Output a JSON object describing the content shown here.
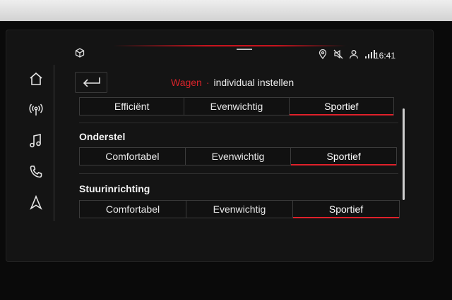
{
  "status": {
    "time": "16:41",
    "icons": [
      "cube-icon",
      "location-pin-icon",
      "mute-icon",
      "person-icon",
      "signal-bars-icon"
    ]
  },
  "sidebar": {
    "items": [
      {
        "icon": "home-icon"
      },
      {
        "icon": "radio-icon"
      },
      {
        "icon": "music-note-icon"
      },
      {
        "icon": "phone-icon"
      },
      {
        "icon": "navigation-arrow-icon"
      }
    ]
  },
  "header": {
    "category": "Wagen",
    "separator": "·",
    "title": "individual instellen",
    "back_icon": "back-arrow-icon"
  },
  "sections": {
    "aandrijving": {
      "options": [
        "Efficiënt",
        "Evenwichtig",
        "Sportief"
      ],
      "selected": "Sportief"
    },
    "onderstel": {
      "label": "Onderstel",
      "options": [
        "Comfortabel",
        "Evenwichtig",
        "Sportief"
      ],
      "selected": "Sportief"
    },
    "stuurinrichting": {
      "label": "Stuurinrichting",
      "options": [
        "Comfortabel",
        "Evenwichtig",
        "Sportief"
      ],
      "selected": "Sportief"
    }
  },
  "colors": {
    "accent": "#d8232a",
    "background": "#141414",
    "text": "#ececec"
  }
}
